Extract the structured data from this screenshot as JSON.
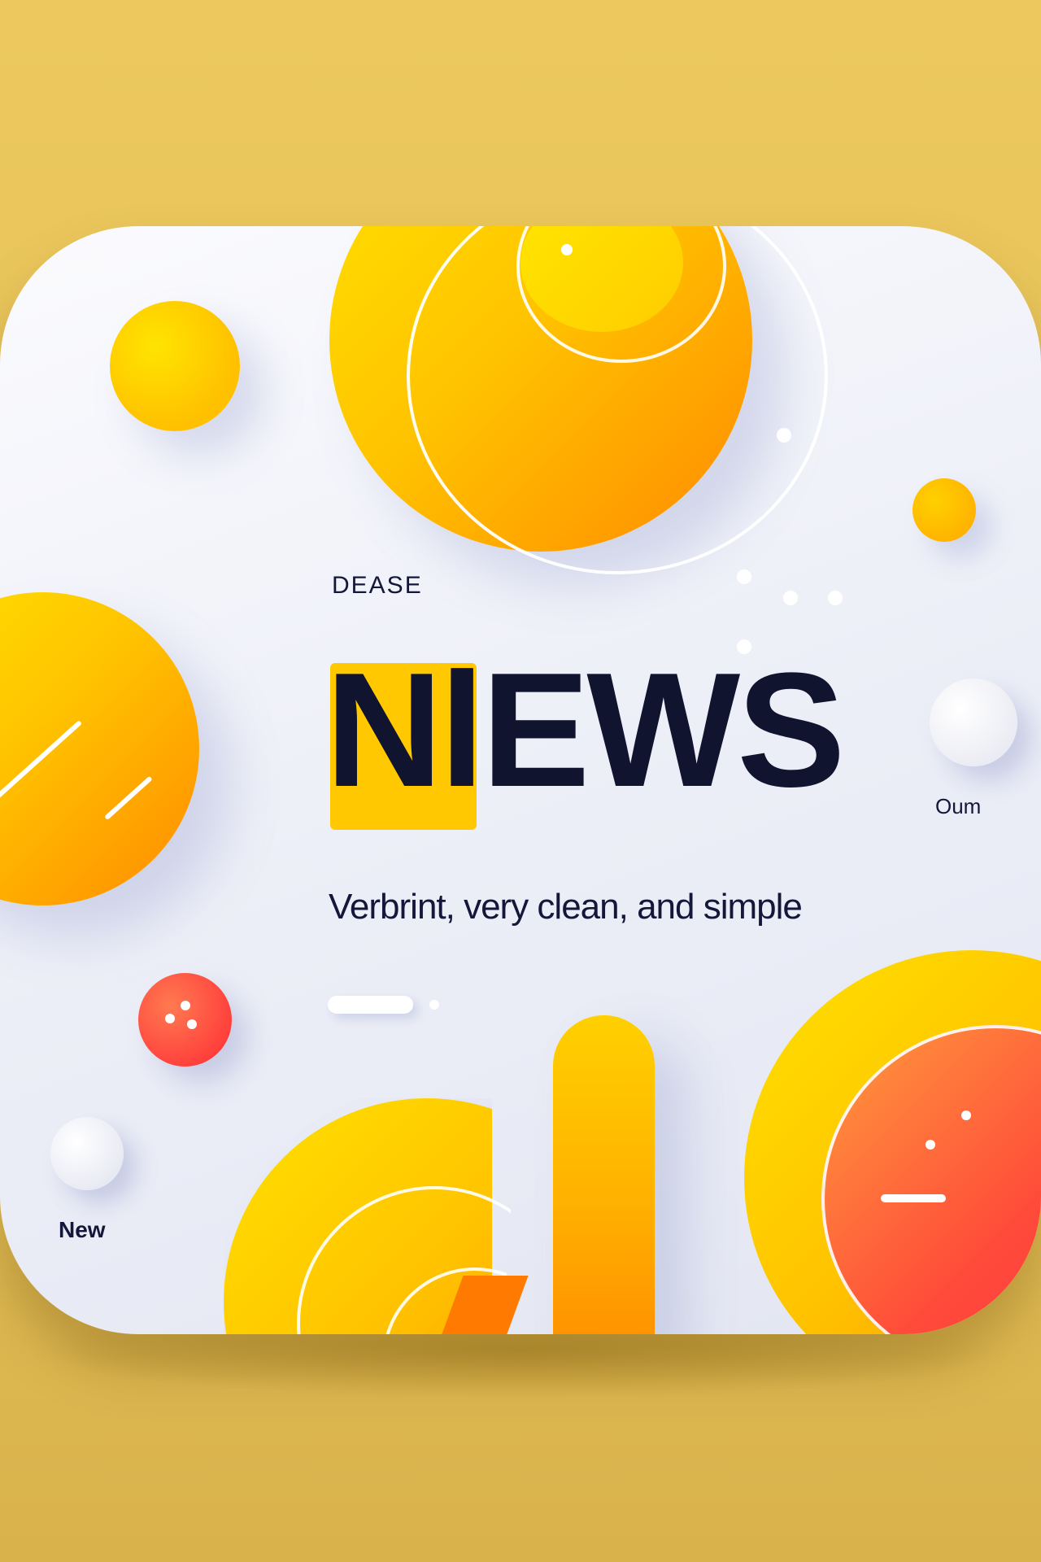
{
  "labels": {
    "top_label": "DEASE",
    "title": "NlEWS",
    "side_label": "Oum",
    "tagline": "Verbrint, very clean, and simple",
    "bottom_label": "New"
  },
  "colors": {
    "background": "#e8c45a",
    "card": "#eef0f8",
    "yellow": "#ffc800",
    "orange": "#ff8a00",
    "red": "#ff2a45",
    "text": "#14173a"
  }
}
